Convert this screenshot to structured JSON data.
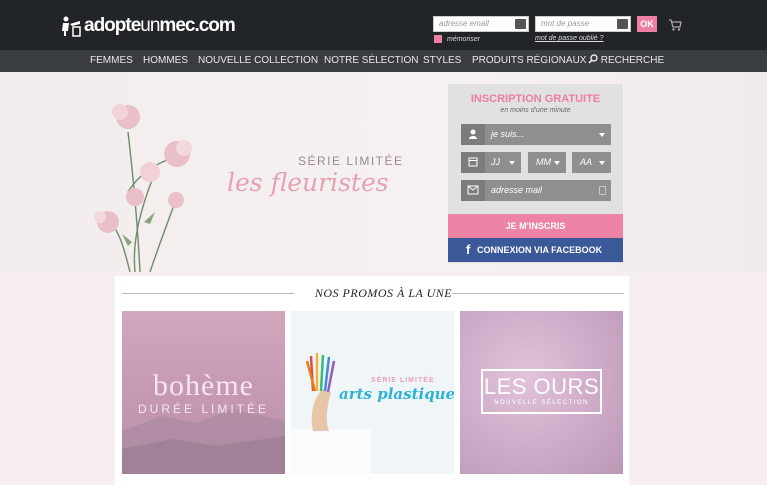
{
  "header": {
    "logo": {
      "part1": "adopte",
      "part2": "un",
      "part3": "mec.com"
    },
    "email_placeholder": "adresse email",
    "password_placeholder": "mot de passe",
    "ok_label": "OK",
    "remember_label": "mémoriser",
    "forgot_label": "mot de passe oublié ?"
  },
  "nav": {
    "items": [
      "FEMMES",
      "HOMMES",
      "NOUVELLE COLLECTION",
      "NOTRE SÉLECTION",
      "STYLES",
      "PRODUITS RÉGIONAUX",
      "RECHERCHE"
    ]
  },
  "hero": {
    "kicker": "SÉRIE LIMITÉE",
    "title": "les fleuristes"
  },
  "signup": {
    "title": "INSCRIPTION GRATUITE",
    "subtitle": "en moins d'une minute",
    "gender_select": "je suis...",
    "day": "JJ",
    "month": "MM",
    "year": "AA",
    "email_placeholder": "adresse mail",
    "submit": "JE M'INSCRIS",
    "facebook": "CONNEXION VIA FACEBOOK"
  },
  "promos": {
    "title": "NOS PROMOS À LA UNE",
    "cards": [
      {
        "title": "bohème",
        "subtitle": "DURÉE LIMITÉE"
      },
      {
        "kicker": "SÉRIE LIMITÉE",
        "title": "arts plastiques"
      },
      {
        "title": "LES OURS",
        "subtitle": "NOUVELLE SÉLECTION"
      }
    ]
  }
}
